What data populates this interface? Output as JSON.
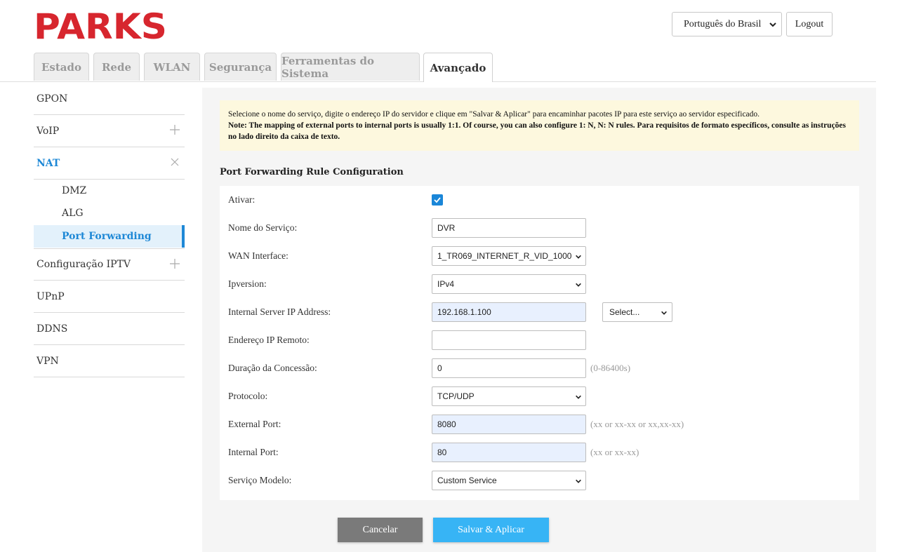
{
  "header": {
    "logo_text": "PARKS",
    "language": "Português do Brasil",
    "logout_label": "Logout"
  },
  "tabs": [
    {
      "label": "Estado"
    },
    {
      "label": "Rede"
    },
    {
      "label": "WLAN"
    },
    {
      "label": "Segurança"
    },
    {
      "label": "Ferramentas do Sistema"
    },
    {
      "label": "Avançado"
    }
  ],
  "active_tab": "Avançado",
  "sidebar": {
    "items": [
      {
        "label": "GPON"
      },
      {
        "label": "VoIP",
        "toggle": "+"
      },
      {
        "label": "NAT",
        "toggle": "×"
      },
      {
        "label": "Configuração IPTV",
        "toggle": "+"
      },
      {
        "label": "UPnP"
      },
      {
        "label": "DDNS"
      },
      {
        "label": "VPN"
      }
    ],
    "nat_subitems": [
      {
        "label": "DMZ"
      },
      {
        "label": "ALG"
      },
      {
        "label": "Port Forwarding"
      }
    ]
  },
  "notice": {
    "line1": "Selecione o nome do serviço, digite o endereço IP do servidor e clique em \"Salvar & Aplicar\" para encaminhar pacotes IP para este serviço ao servidor especificado.",
    "line2": "Note: The mapping of external ports to internal ports is usually 1:1. Of course, you can also configure 1: N, N: N rules. Para requisitos de formato específicos, consulte as instruções no lado direito da caixa de texto."
  },
  "section_title": "Port Forwarding Rule Configuration",
  "form": {
    "ativar": {
      "label": "Ativar:",
      "checked": true
    },
    "nome_servico": {
      "label": "Nome do Serviço:",
      "value": "DVR"
    },
    "wan_interface": {
      "label": "WAN Interface:",
      "value": "1_TR069_INTERNET_R_VID_1000"
    },
    "ipversion": {
      "label": "Ipversion:",
      "value": "IPv4"
    },
    "internal_ip": {
      "label": "Internal Server IP Address:",
      "value": "192.168.1.100",
      "select_value": "Select..."
    },
    "remote_ip": {
      "label": "Endereço IP Remoto:",
      "value": ""
    },
    "lease": {
      "label": "Duração da Concessão:",
      "value": "0",
      "hint": "(0-86400s)"
    },
    "protocol": {
      "label": "Protocolo:",
      "value": "TCP/UDP"
    },
    "external_port": {
      "label": "External Port:",
      "value": "8080",
      "hint": "(xx or xx-xx or xx,xx-xx)"
    },
    "internal_port": {
      "label": "Internal Port:",
      "value": "80",
      "hint": "(xx or xx-xx)"
    },
    "service_template": {
      "label": "Serviço Modelo:",
      "value": "Custom Service"
    }
  },
  "buttons": {
    "cancel": "Cancelar",
    "save": "Salvar & Aplicar"
  },
  "colors": {
    "brand_red": "#d7262e",
    "accent_blue": "#1e88d6",
    "save_button": "#37b4f5",
    "cancel_button": "#7a7a7a",
    "notice_bg": "#fdf8de",
    "autofill_bg": "#e8f0fe"
  }
}
